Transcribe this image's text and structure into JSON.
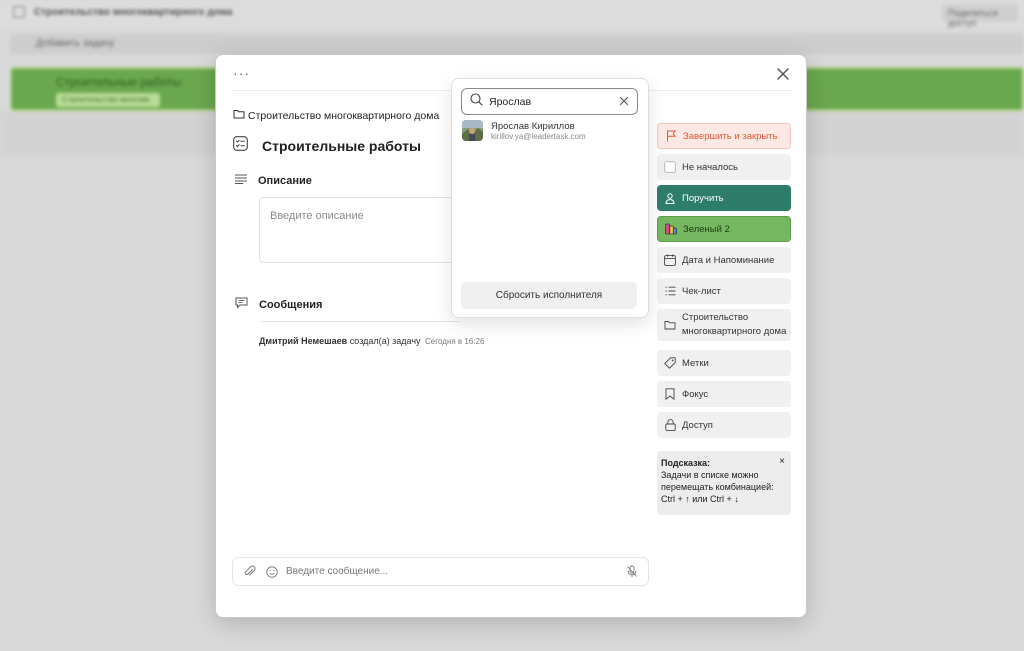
{
  "background": {
    "project_title": "Строительство многоквартирного дома",
    "share_label": "Поделиться доступ",
    "add_task_label": "Добавить задачу",
    "card_title": "Строительные работы",
    "card_tag": "Строительство многокв."
  },
  "modal": {
    "more_label": "···",
    "breadcrumb": "Строительство многоквартирного дома",
    "task_title": "Строительные работы",
    "description": {
      "label": "Описание",
      "placeholder": "Введите описание"
    },
    "messages": {
      "label": "Сообщения",
      "log": {
        "author": "Дмитрий Немешаев",
        "action": "создал(а) задачу",
        "time": "Сегодня в 16:26"
      }
    },
    "composer": {
      "placeholder": "Введите сообщение..."
    }
  },
  "actions": {
    "finish": "Завершить и закрыть",
    "not_started": "Не началось",
    "assign": "Поручить",
    "color": "Зеленый 2",
    "date": "Дата и Напоминание",
    "checklist": "Чек-лист",
    "project_line1": "Строительство",
    "project_line2": "многоквартирного дома",
    "tags": "Метки",
    "focus": "Фокус",
    "access": "Доступ"
  },
  "hint": {
    "title": "Подсказка:",
    "close": "×",
    "text_line1": "Задачи в списке можно",
    "text_line2": "перемещать комбинацией:",
    "text_line3": "Ctrl + ↑ или Ctrl + ↓"
  },
  "assign_popup": {
    "search_value": "Ярослав",
    "user": {
      "name": "Ярослав Кириллов",
      "email": "kirillov.ya@leadertask.com"
    },
    "reset_label": "Сбросить исполнителя"
  },
  "colors": {
    "assign_bg": "#2e7d6b",
    "green_tag": "#76b861",
    "finish_text": "#e05a3a",
    "finish_bg": "#fde8e4"
  }
}
